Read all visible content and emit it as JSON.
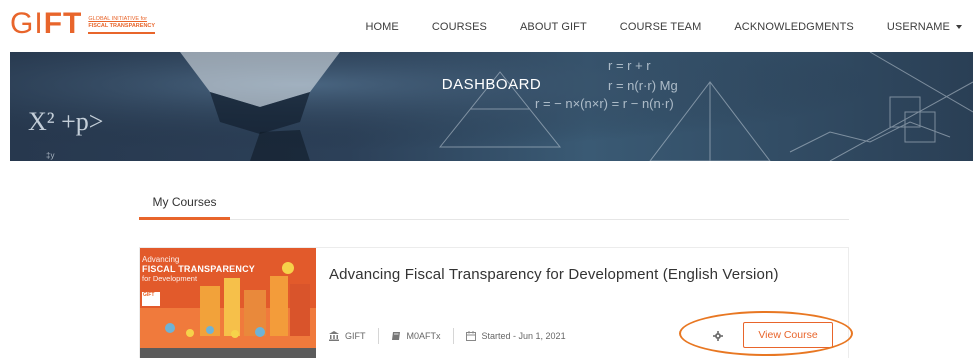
{
  "header": {
    "logo": {
      "big": "GIFT",
      "small_top": "GLOBAL INITIATIVE for",
      "small_bottom": "FISCAL TRANSPARENCY"
    },
    "nav": [
      {
        "label": "HOME"
      },
      {
        "label": "COURSES"
      },
      {
        "label": "ABOUT GIFT"
      },
      {
        "label": "COURSE TEAM"
      },
      {
        "label": "ACKNOWLEDGMENTS"
      },
      {
        "label": "USERNAME"
      }
    ]
  },
  "banner": {
    "title": "DASHBOARD"
  },
  "tabs": [
    {
      "label": "My Courses",
      "active": true
    }
  ],
  "course": {
    "thumbnail": {
      "line1": "Advancing",
      "line2": "FISCAL TRANSPARENCY",
      "line3": "for Development"
    },
    "title": "Advancing Fiscal Transparency for Development (English Version)",
    "org": "GIFT",
    "code": "M0AFTx",
    "started": "Started - Jun 1, 2021",
    "settings_icon": "gear-icon",
    "view_button": "View Course"
  },
  "colors": {
    "accent": "#e8652b",
    "annotation": "#e87722",
    "banner": "#2c4058"
  }
}
